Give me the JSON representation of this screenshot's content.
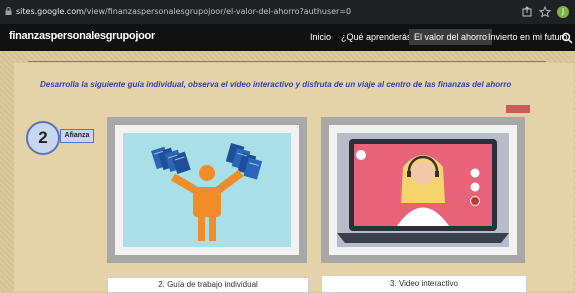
{
  "browser": {
    "url_domain": "sites.google.com",
    "url_path": "/view/finanzaspersonalesgrupojoor/el-valor-del-ahorro?authuser=0",
    "profile_initial": "J"
  },
  "site": {
    "brand": "finanzaspersonalesgrupojoor",
    "nav": [
      {
        "label": "Inicio",
        "active": false
      },
      {
        "label": "¿Qué aprenderás?",
        "active": false
      },
      {
        "label": "El valor del ahorro",
        "active": true
      },
      {
        "label": "Invierto en mi futuro",
        "active": false
      }
    ]
  },
  "content": {
    "instruction": "Desarrolla la siguiente guía individual, observa el vídeo interactivo y disfruta de un viaje al centro de las finanzas del ahorro",
    "step_number": "2",
    "step_tag": "Afianza",
    "cards": [
      {
        "caption": "2. Guía de trabajo individual"
      },
      {
        "caption": "3. Video interactivo"
      }
    ]
  },
  "colors": {
    "instruction": "#2f3fb5",
    "accent_red": "#c85b5b",
    "page_bg": "#dbc79a"
  }
}
